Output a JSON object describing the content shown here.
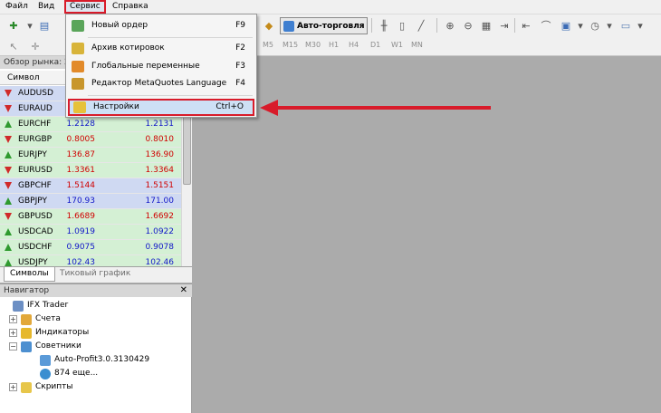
{
  "menubar": {
    "items": [
      "Файл",
      "Вид",
      "Сервис",
      "Справка"
    ]
  },
  "toolbar": {
    "auto_trading_label": "Авто-торговля",
    "timeframes": [
      "M5",
      "M15",
      "M30",
      "H1",
      "H4",
      "D1",
      "W1",
      "MN"
    ]
  },
  "market_watch": {
    "title": "Обзор рынка: 2",
    "column_symbol": "Символ",
    "rows": [
      {
        "symbol": "AUDUSD",
        "bid": "",
        "ask": "",
        "dir": "down",
        "highlight": "blue"
      },
      {
        "symbol": "EURAUD",
        "bid": "",
        "ask": "",
        "dir": "down",
        "highlight": "blue"
      },
      {
        "symbol": "EURCHF",
        "bid": "1.2128",
        "ask": "1.2131",
        "dir": "up",
        "highlight": "green",
        "color": "blue"
      },
      {
        "symbol": "EURGBP",
        "bid": "0.8005",
        "ask": "0.8010",
        "dir": "down",
        "highlight": "green",
        "color": "red"
      },
      {
        "symbol": "EURJPY",
        "bid": "136.87",
        "ask": "136.90",
        "dir": "up",
        "highlight": "green",
        "color": "red"
      },
      {
        "symbol": "EURUSD",
        "bid": "1.3361",
        "ask": "1.3364",
        "dir": "down",
        "highlight": "green",
        "color": "red"
      },
      {
        "symbol": "GBPCHF",
        "bid": "1.5144",
        "ask": "1.5151",
        "dir": "down",
        "highlight": "blue",
        "color": "red"
      },
      {
        "symbol": "GBPJPY",
        "bid": "170.93",
        "ask": "171.00",
        "dir": "up",
        "highlight": "blue",
        "color": "blue"
      },
      {
        "symbol": "GBPUSD",
        "bid": "1.6689",
        "ask": "1.6692",
        "dir": "down",
        "highlight": "green",
        "color": "red"
      },
      {
        "symbol": "USDCAD",
        "bid": "1.0919",
        "ask": "1.0922",
        "dir": "up",
        "highlight": "green",
        "color": "blue"
      },
      {
        "symbol": "USDCHF",
        "bid": "0.9075",
        "ask": "0.9078",
        "dir": "up",
        "highlight": "green",
        "color": "blue"
      },
      {
        "symbol": "USDJPY",
        "bid": "102.43",
        "ask": "102.46",
        "dir": "up",
        "highlight": "green",
        "color": "blue"
      }
    ],
    "tabs": [
      "Символы",
      "Тиковый график"
    ]
  },
  "navigator": {
    "title": "Навигатор",
    "root": "IFX Trader",
    "nodes": {
      "accounts": "Счета",
      "indicators": "Индикаторы",
      "experts": "Советники",
      "expert_1": "Auto-Profit3.0.3130429",
      "expert_more": "874 еще...",
      "scripts": "Скрипты"
    }
  },
  "service_menu": {
    "items": [
      {
        "label": "Новый ордер",
        "shortcut": "F9"
      },
      {
        "label": "Архив котировок",
        "shortcut": "F2"
      },
      {
        "label": "Глобальные переменные",
        "shortcut": "F3"
      },
      {
        "label": "Редактор MetaQuotes Language",
        "shortcut": "F4"
      },
      {
        "label": "Настройки",
        "shortcut": "Ctrl+O"
      }
    ]
  },
  "colors": {
    "accent_red": "#d81b2a",
    "highlight_blue": "#cfd9f2",
    "highlight_green": "#d4f0d4",
    "price_blue": "#1016c8",
    "price_red": "#d00000"
  }
}
